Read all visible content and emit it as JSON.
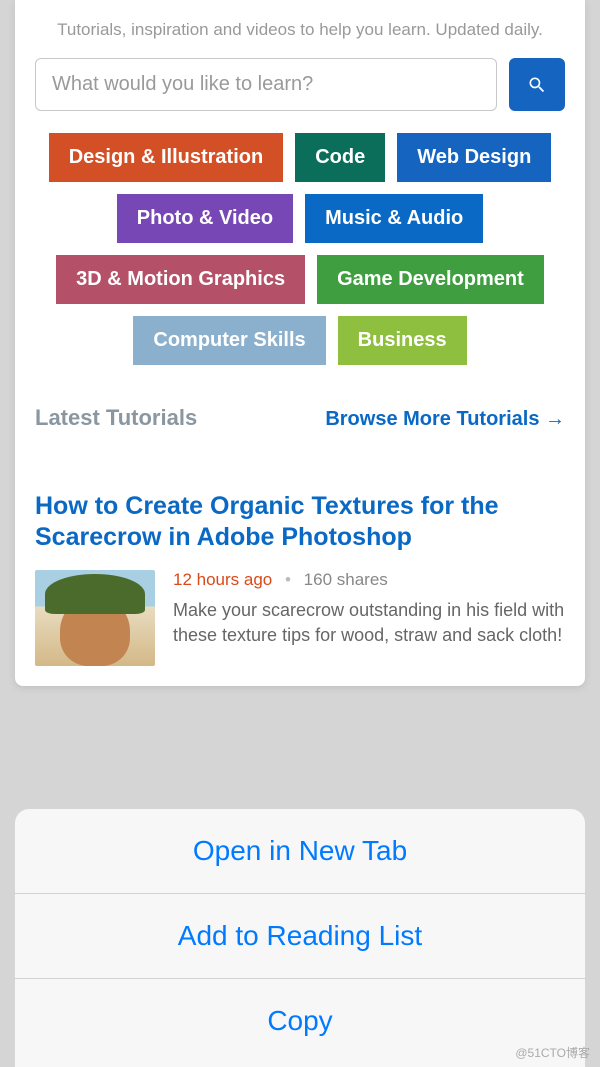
{
  "tagline": "Tutorials, inspiration and videos to help you learn. Updated daily.",
  "search": {
    "placeholder": "What would you like to learn?"
  },
  "categories": [
    {
      "label": "Design & Illustration",
      "color": "#d35027"
    },
    {
      "label": "Code",
      "color": "#0b6e5b"
    },
    {
      "label": "Web Design",
      "color": "#1565c0"
    },
    {
      "label": "Photo & Video",
      "color": "#7747b6"
    },
    {
      "label": "Music & Audio",
      "color": "#0a69c4"
    },
    {
      "label": "3D & Motion Graphics",
      "color": "#b45168"
    },
    {
      "label": "Game Development",
      "color": "#3f9e3f"
    },
    {
      "label": "Computer Skills",
      "color": "#8bb0ce"
    },
    {
      "label": "Business",
      "color": "#8fbf3f"
    }
  ],
  "section": {
    "title": "Latest Tutorials",
    "browse": "Browse More Tutorials →"
  },
  "article": {
    "title": "How to Create Organic Textures for the Scarecrow in Adobe Photoshop",
    "time": "12 hours ago",
    "separator": "•",
    "shares": "160 shares",
    "excerpt": "Make your scarecrow outstanding in his field with these texture tips for wood, straw and sack cloth!"
  },
  "actions": {
    "open": "Open in New Tab",
    "add": "Add to Reading List",
    "copy": "Copy"
  },
  "watermark": "@51CTO博客"
}
